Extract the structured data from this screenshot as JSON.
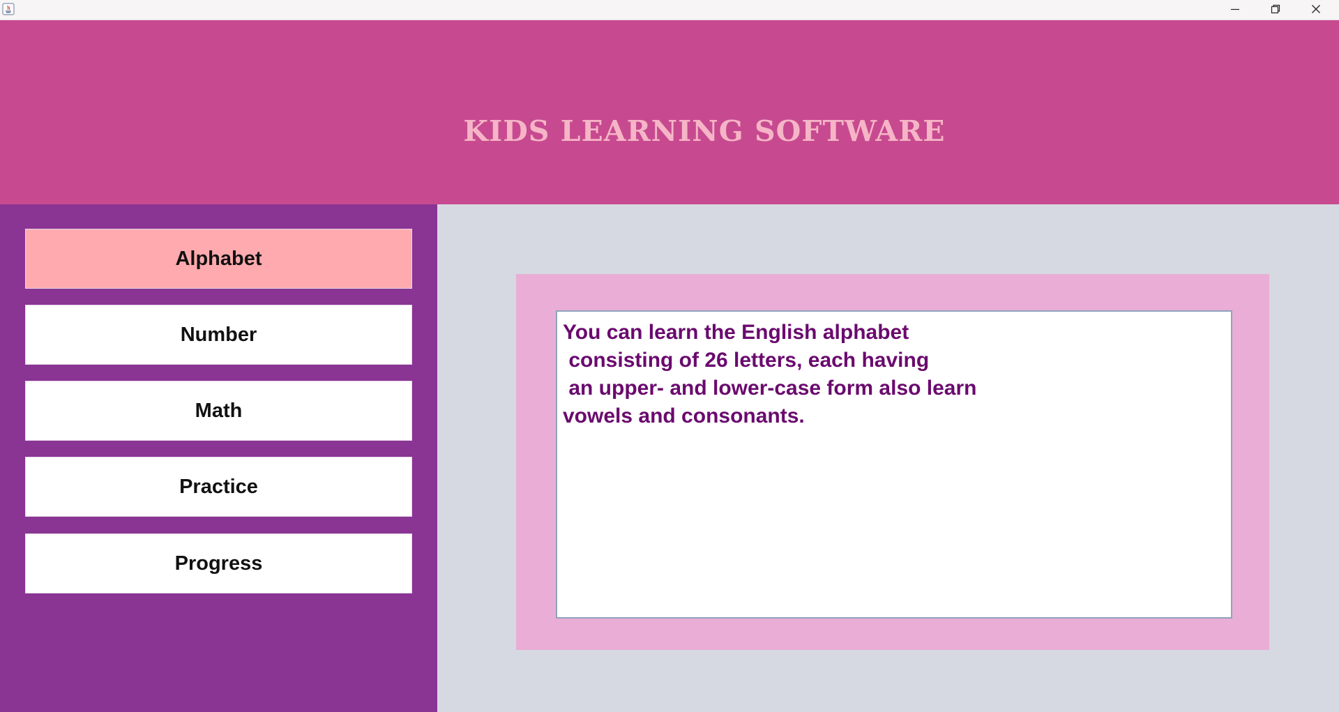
{
  "window": {
    "icon": "java-app-icon",
    "controls": [
      "minimize-icon",
      "restore-icon",
      "close-icon"
    ]
  },
  "header": {
    "title": "KIDS LEARNING SOFTWARE",
    "background": "#c74a90",
    "title_color": "#f6b5c7"
  },
  "sidebar": {
    "background": "#8a3494",
    "items": [
      {
        "label": "Alphabet",
        "active": true
      },
      {
        "label": "Number",
        "active": false
      },
      {
        "label": "Math",
        "active": false
      },
      {
        "label": "Practice",
        "active": false
      },
      {
        "label": "Progress",
        "active": false
      }
    ],
    "active_color": "#ffaaae"
  },
  "content": {
    "background": "#d6d9e1",
    "frame_color": "#eaadd5",
    "text_color": "#6a0a6e",
    "description": "You can learn the English alphabet\n consisting of 26 letters, each having\n an upper- and lower-case form also learn\nvowels and consonants."
  }
}
